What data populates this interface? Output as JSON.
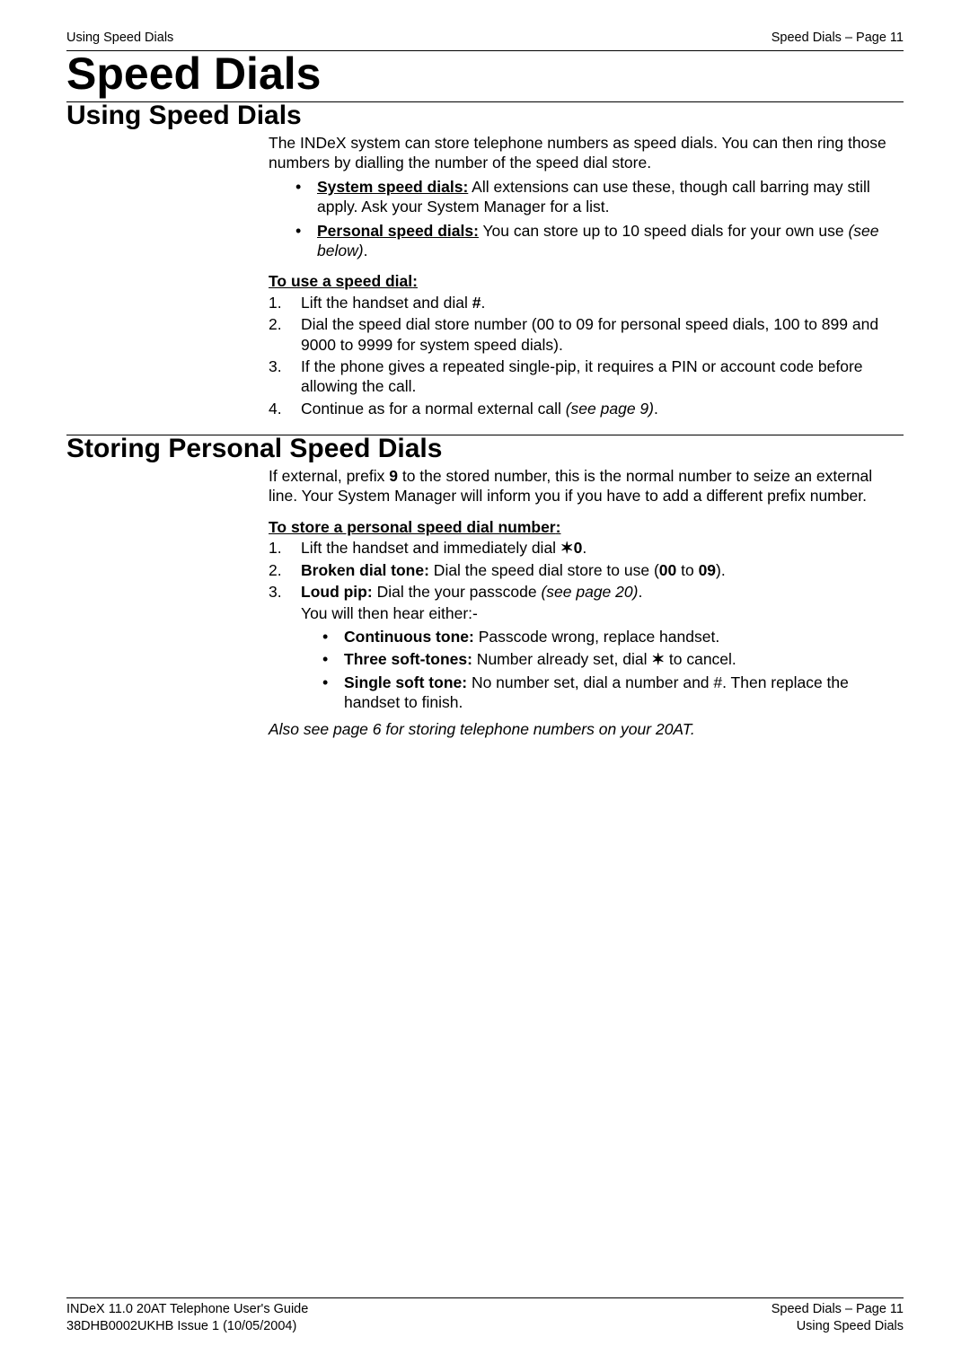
{
  "header": {
    "left": "Using Speed Dials",
    "right": "Speed Dials – Page 11"
  },
  "main_title": "Speed Dials",
  "section1": {
    "title": "Using Speed Dials",
    "intro": "The INDeX system can store telephone numbers as speed dials. You can then ring those numbers by dialling the number of the speed dial store.",
    "bullets": [
      {
        "label": "System speed dials:",
        "text": " All extensions can use these,  though call barring may still apply. Ask your System Manager for a list."
      },
      {
        "label": "Personal speed dials:",
        "text": " You can store up to 10 speed dials for your own use ",
        "italic": "(see below)",
        "tail": "."
      }
    ],
    "subhead": "To use a speed dial",
    "steps": [
      {
        "n": "1.",
        "pre": "Lift the handset and dial ",
        "bold": "#",
        "post": "."
      },
      {
        "n": "2.",
        "text": "Dial the speed dial store number (00 to 09 for personal speed dials, 100 to 899 and 9000 to 9999 for system speed dials)."
      },
      {
        "n": "3.",
        "text": "If the phone gives a repeated single-pip, it requires a PIN or account code before allowing the call."
      },
      {
        "n": "4.",
        "pre": "Continue as for a normal external call ",
        "italic": "(see page 9)",
        "post": "."
      }
    ]
  },
  "section2": {
    "title": "Storing Personal Speed Dials",
    "intro_pre": "If external, prefix ",
    "intro_bold": "9",
    "intro_post": " to the stored number, this is the normal number to seize an external line. Your System Manager will inform you if you have to add a different prefix number.",
    "subhead": "To store a personal speed dial number",
    "steps": [
      {
        "n": "1.",
        "pre": "Lift the handset and immediately dial ",
        "star": "✶",
        "bold2": "0",
        "post": "."
      },
      {
        "n": "2.",
        "bold": "Broken dial tone:",
        "mid": " Dial the speed dial store to use (",
        "bold2": "00",
        "mid2": " to ",
        "bold3": "09",
        "post": ")."
      },
      {
        "n": "3.",
        "bold": "Loud pip:",
        "mid": " Dial the your passcode ",
        "italic": "(see page 20)",
        "post": ".",
        "tail_line": "You will then hear either:-",
        "inner": [
          {
            "bold": "Continuous tone:",
            "text": " Passcode wrong, replace handset."
          },
          {
            "bold": "Three soft-tones:",
            "text_pre": " Number already set, dial ",
            "star": "✶",
            "text_post": " to cancel."
          },
          {
            "bold": "Single soft tone:",
            "text": " No number set, dial a number and #. Then replace the handset to finish."
          }
        ]
      }
    ],
    "also": "Also see page 6 for storing telephone numbers on your 20AT."
  },
  "footer": {
    "left1": "INDeX 11.0 20AT Telephone User's Guide",
    "left2": "38DHB0002UKHB Issue 1 (10/05/2004)",
    "right1": "Speed Dials – Page 11",
    "right2": "Using Speed Dials"
  }
}
